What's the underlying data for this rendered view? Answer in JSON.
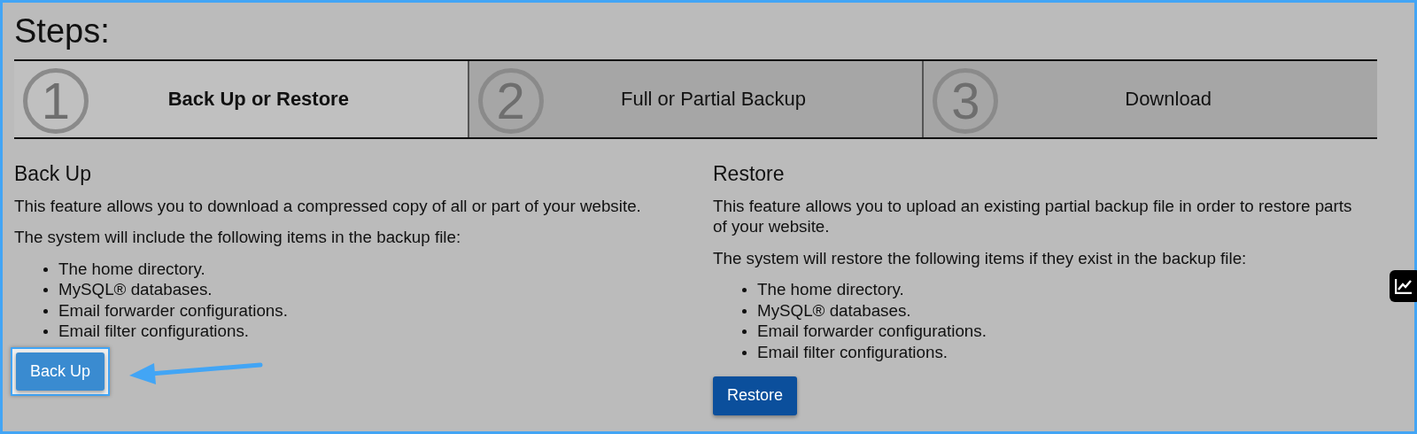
{
  "title": "Steps:",
  "steps": [
    {
      "number": "1",
      "label": "Back Up or Restore",
      "selected": true
    },
    {
      "number": "2",
      "label": "Full or Partial Backup",
      "selected": false
    },
    {
      "number": "3",
      "label": "Download",
      "selected": false
    }
  ],
  "sections": [
    {
      "heading": "Back Up",
      "paragraphs": [
        "This feature allows you to download a compressed copy of all or part of your website.",
        "The system will include the following items in the backup file:"
      ],
      "items": [
        "The home directory.",
        "MySQL® databases.",
        "Email forwarder configurations.",
        "Email filter configurations."
      ],
      "button": {
        "label": "Back Up",
        "kind": "light",
        "highlighted": true
      }
    },
    {
      "heading": "Restore",
      "paragraphs": [
        "This feature allows you to upload an existing partial backup file in order to restore parts of your website.",
        "The system will restore the following items if they exist in the backup file:"
      ],
      "items": [
        "The home directory.",
        "MySQL® databases.",
        "Email forwarder configurations.",
        "Email filter configurations."
      ],
      "button": {
        "label": "Restore",
        "kind": "dark",
        "highlighted": false
      }
    }
  ]
}
